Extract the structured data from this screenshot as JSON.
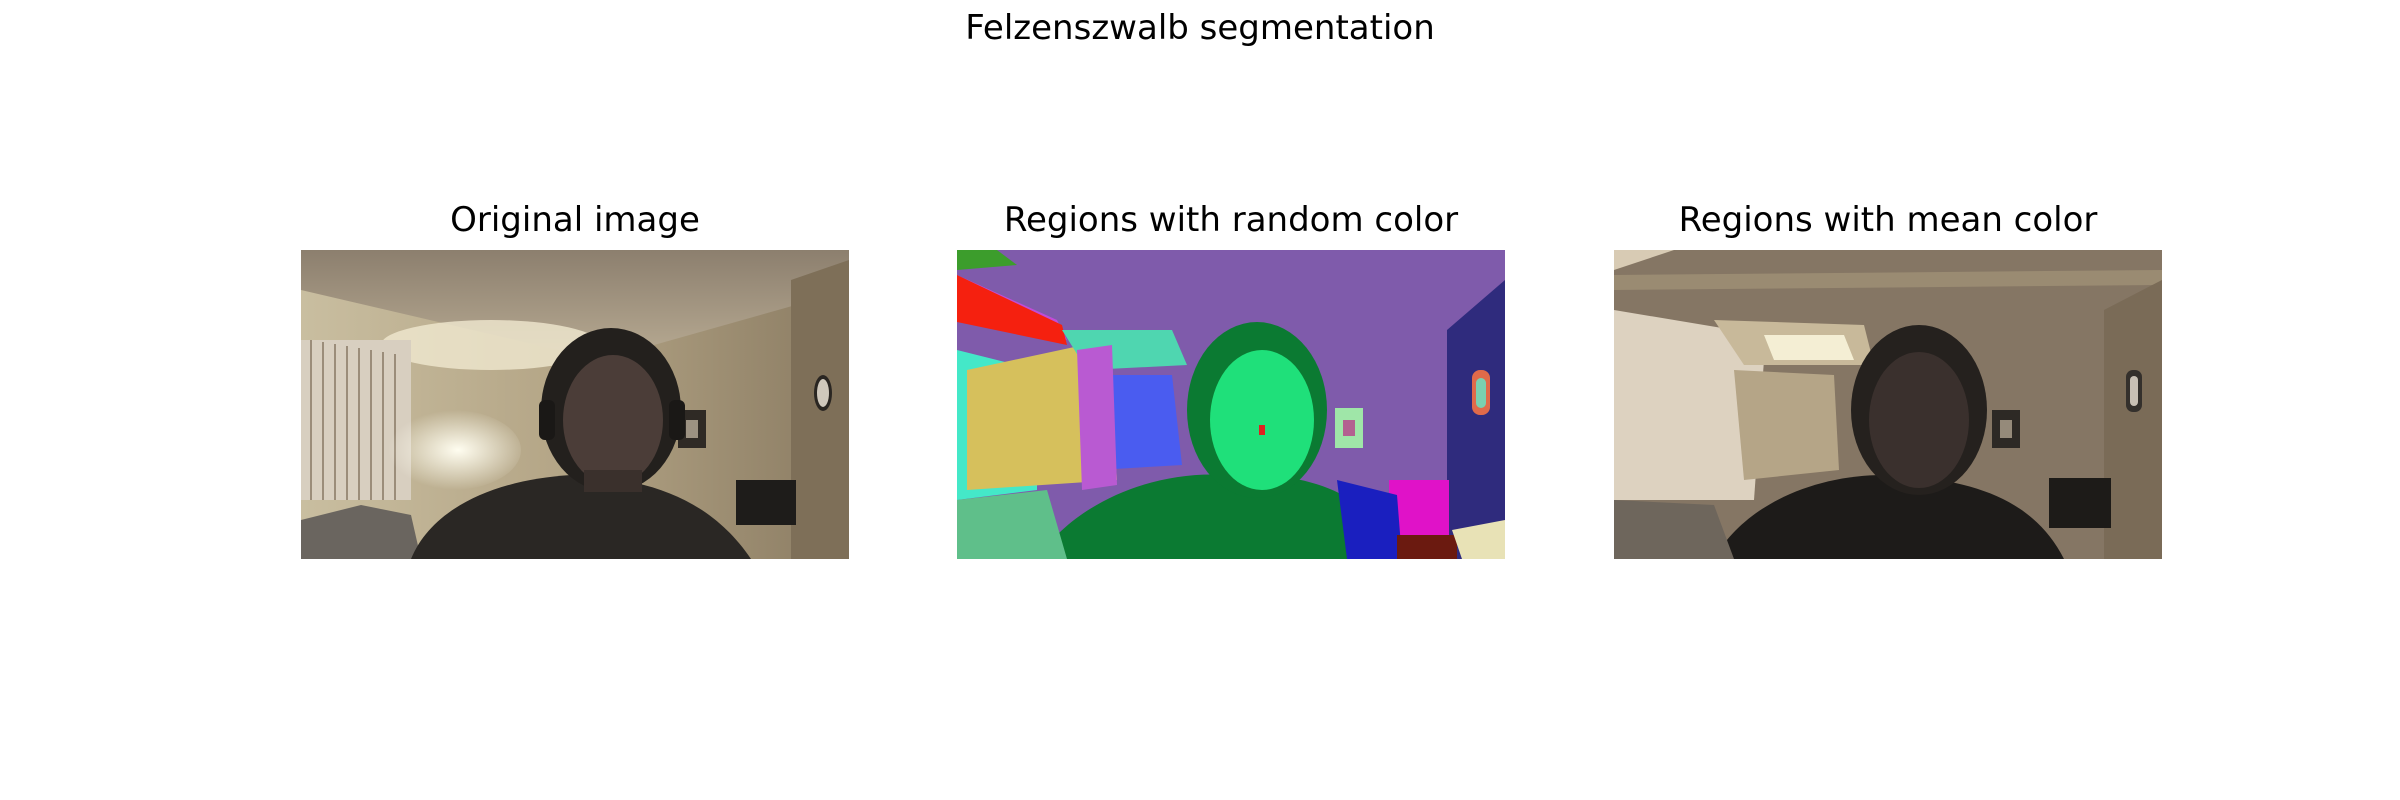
{
  "figure": {
    "title": "Felzenszwalb segmentation"
  },
  "panels": [
    {
      "title": "Original image",
      "content": "webcam-photo"
    },
    {
      "title": "Regions with random color",
      "content": "segmentation-random-color"
    },
    {
      "title": "Regions with mean color",
      "content": "segmentation-mean-color"
    }
  ]
}
